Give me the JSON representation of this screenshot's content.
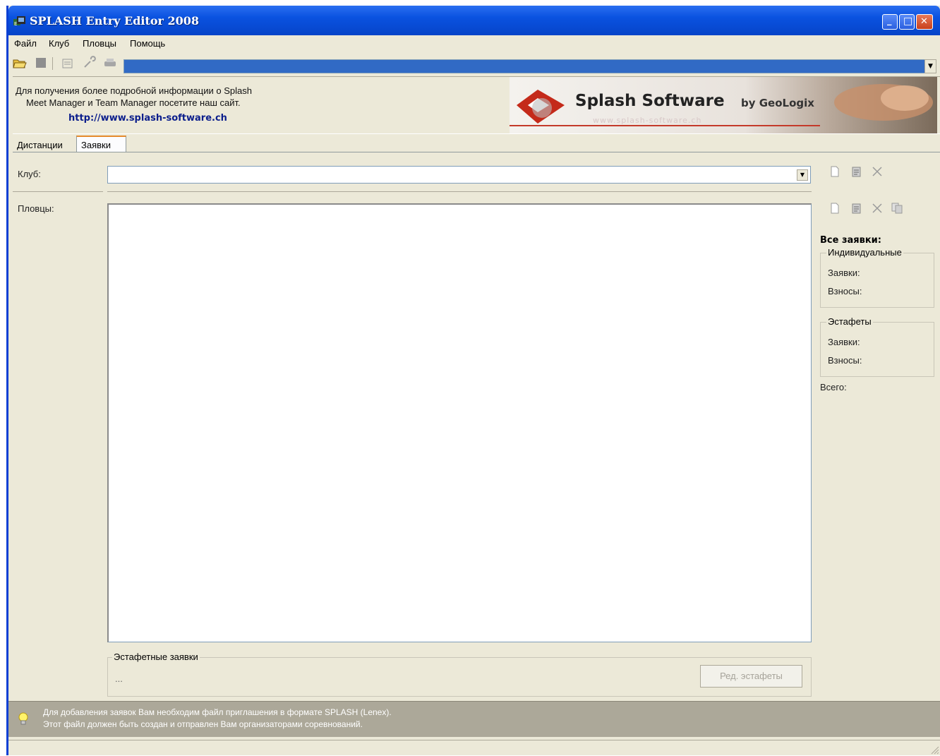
{
  "window": {
    "title": "SPLASH Entry Editor 2008",
    "controls": {
      "minimize": "_",
      "maximize": "□",
      "close": "✕"
    }
  },
  "menu": [
    "Файл",
    "Клуб",
    "Пловцы",
    "Помощь"
  ],
  "toolbar": {
    "icons": [
      "open-folder-icon",
      "stop-icon",
      "properties-icon",
      "wrench-icon",
      "printer-icon"
    ]
  },
  "info": {
    "line1": "Для получения более подробной информации о Splash",
    "line2": "Meet Manager и Team Manager посетите наш сайт.",
    "link": "http://www.splash-software.ch",
    "banner_title": "Splash Software",
    "banner_by": "by GeoLogix",
    "banner_sub": "www.splash-software.ch"
  },
  "tabs": [
    "Дистанции",
    "Заявки"
  ],
  "form": {
    "club_label": "Клуб:",
    "club_value": "",
    "swimmers_label": "Пловцы:"
  },
  "summary": {
    "title": "Все заявки:",
    "individual_title": "Индивидуальные",
    "individual_entries": "Заявки:",
    "individual_fees": "Взносы:",
    "relay_title": "Эстафеты",
    "relay_entries": "Заявки:",
    "relay_fees": "Взносы:",
    "total": "Всего:"
  },
  "relay_section": {
    "title": "Эстафетные заявки",
    "value": "...",
    "button": "Ред. эстафеты"
  },
  "hint": {
    "line1": "Для добавления заявок Вам необходим файл приглашения в формате SPLASH (Lenex).",
    "line2": "Этот файл должен быть создан и отправлен Вам организаторами соревнований."
  },
  "colors": {
    "titlebar": "#0a52e0",
    "window_bg": "#ece9d8",
    "hint_bg": "#aca899",
    "link": "#0b1e8c",
    "selection": "#316ac5"
  }
}
